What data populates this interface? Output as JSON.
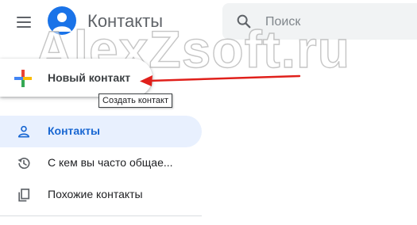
{
  "header": {
    "app_title": "Контакты",
    "search_placeholder": "Поиск"
  },
  "watermark": "AlexZsoft.ru",
  "new_contact": {
    "label": "Новый контакт",
    "tooltip": "Создать контакт"
  },
  "sidebar": {
    "items": [
      {
        "label": "Контакты",
        "icon": "person-icon",
        "active": true
      },
      {
        "label": "С кем вы часто общае...",
        "icon": "history-icon",
        "active": false
      },
      {
        "label": "Похожие контакты",
        "icon": "copy-icon",
        "active": false
      }
    ]
  },
  "colors": {
    "accent": "#1a73e8",
    "active_bg": "#e8f0fe",
    "annotation_arrow": "#e0201b"
  }
}
